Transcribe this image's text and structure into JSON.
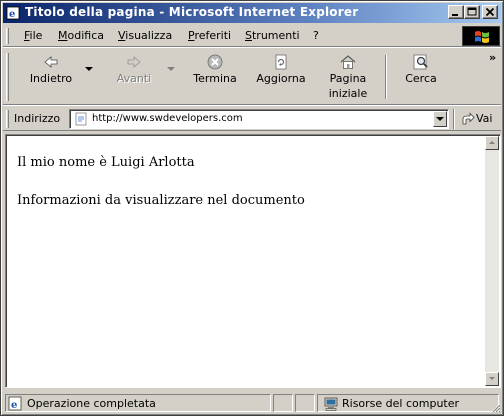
{
  "window": {
    "title": "Titolo della pagina - Microsoft Internet Explorer",
    "colors": {
      "titlebar_start": "#0a246a",
      "titlebar_end": "#a6caf0",
      "chrome": "#d4d0c8"
    }
  },
  "menu": {
    "items": [
      {
        "label": "File"
      },
      {
        "label": "Modifica"
      },
      {
        "label": "Visualizza"
      },
      {
        "label": "Preferiti"
      },
      {
        "label": "Strumenti"
      },
      {
        "label": "?"
      }
    ]
  },
  "toolbar": {
    "back": {
      "label": "Indietro",
      "icon": "back-arrow-icon",
      "enabled": true
    },
    "forward": {
      "label": "Avanti",
      "icon": "forward-arrow-icon",
      "enabled": false
    },
    "stop": {
      "label": "Termina",
      "icon": "stop-icon"
    },
    "refresh": {
      "label": "Aggiorna",
      "icon": "refresh-icon"
    },
    "home": {
      "label_line1": "Pagina",
      "label_line2": "iniziale",
      "icon": "home-icon"
    },
    "search": {
      "label": "Cerca",
      "icon": "search-icon"
    },
    "more": "»"
  },
  "address": {
    "label": "Indirizzo",
    "value": "http://www.swdevelopers.com",
    "go_label": "Vai"
  },
  "document": {
    "lines": [
      "Il mio nome è Luigi Arlotta",
      "Informazioni da visualizzare nel documento"
    ]
  },
  "status": {
    "text": "Operazione completata",
    "zone": "Risorse del computer"
  }
}
